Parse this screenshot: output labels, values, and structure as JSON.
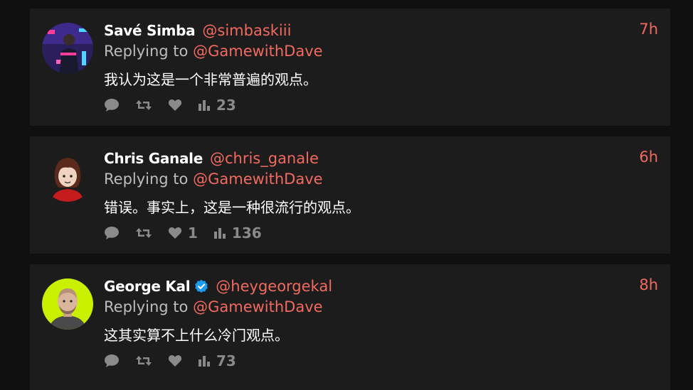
{
  "tweets": [
    {
      "name": "Savé Simba",
      "handle": "@simbaskiii",
      "time": "7h",
      "reply_prefix": "Replying to",
      "reply_to": "@GamewithDave",
      "text": "我认为这是一个非常普遍的观点。",
      "likes": "",
      "views": "23",
      "verified": false
    },
    {
      "name": "Chris Ganale",
      "handle": "@chris_ganale",
      "time": "6h",
      "reply_prefix": "Replying to",
      "reply_to": "@GamewithDave",
      "text": "错误。事实上，这是一种很流行的观点。",
      "likes": "1",
      "views": "136",
      "verified": false
    },
    {
      "name": "George Kal",
      "handle": "@heygeorgekal",
      "time": "8h",
      "reply_prefix": "Replying to",
      "reply_to": "@GamewithDave",
      "text": "这其实算不上什么冷门观点。",
      "likes": "",
      "views": "73",
      "verified": true
    }
  ],
  "colors": {
    "accent": "#f26a5f",
    "card": "#1c1c1c",
    "background": "#101010",
    "icon": "#8a8a8a",
    "verified": "#1d9bf0"
  },
  "icons": [
    "comment-icon",
    "retweet-icon",
    "heart-icon",
    "views-icon",
    "verified-badge-icon"
  ]
}
